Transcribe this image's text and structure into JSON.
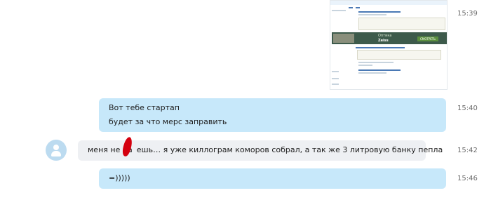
{
  "messages": [
    {
      "time": "15:39"
    },
    {
      "time": "15:40",
      "lines": [
        "Вот тебе стартап",
        "будет за что мерс заправить"
      ]
    },
    {
      "time": "15:42",
      "text_before": "меня не на",
      "text_after": "ешь… я уже киллограм коморов собрал, а так же 3 литровую банку пепла"
    },
    {
      "time": "15:46",
      "text": "=)))))"
    }
  ],
  "thumbnail": {
    "ad_title": "Оптика",
    "ad_subtitle": "Zeiss",
    "ad_button": "СМОТРЕТЬ"
  },
  "colors": {
    "outgoing_bubble": "#c7e8fa",
    "incoming_bubble": "#eef0f3",
    "avatar": "#bcdbf0",
    "censor_mark": "#d4000e"
  },
  "icons": {
    "avatar": "default-user-avatar-icon"
  }
}
